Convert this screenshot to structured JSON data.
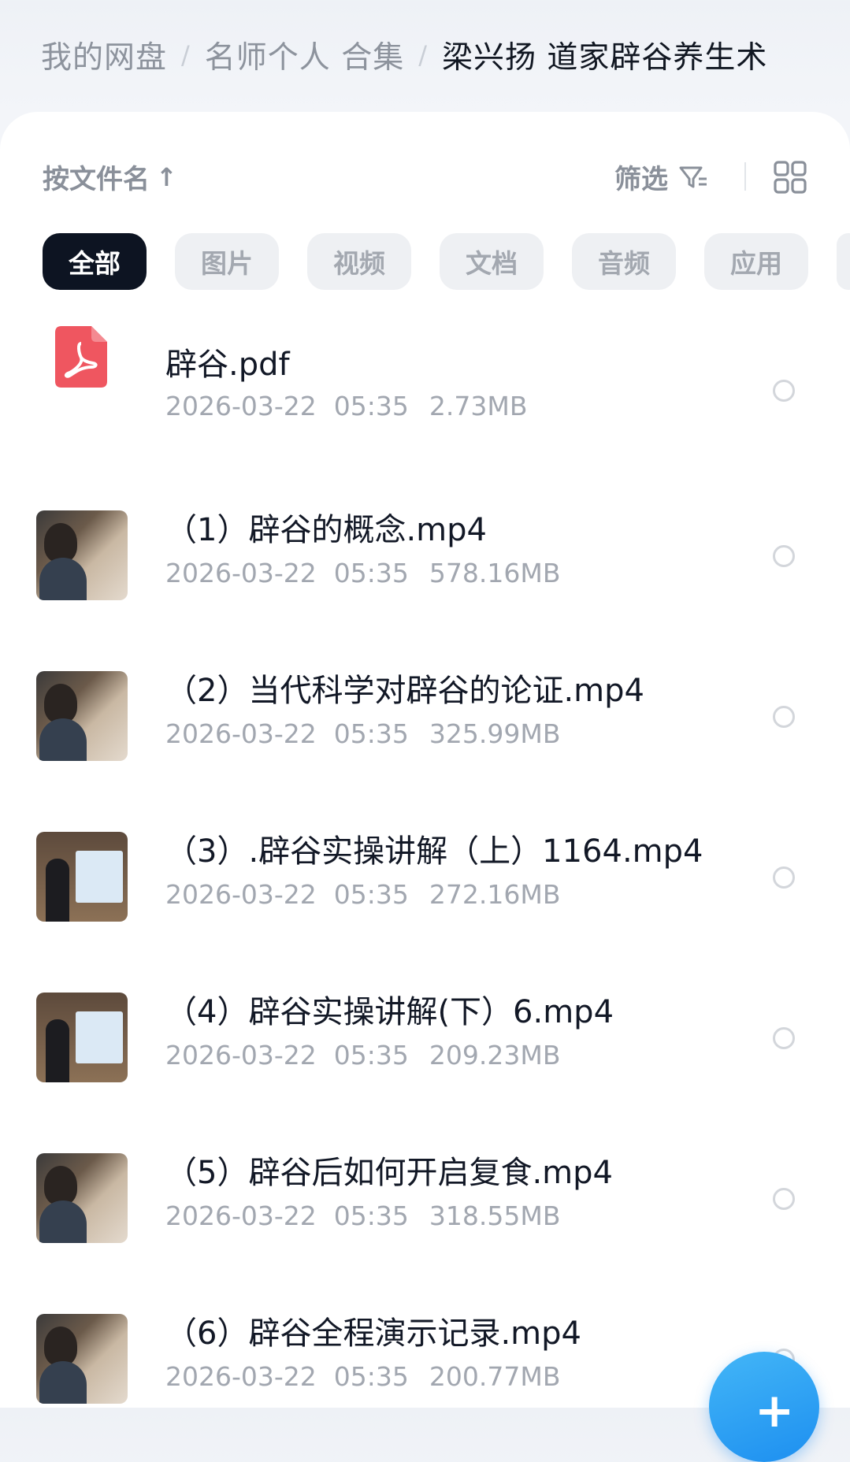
{
  "breadcrumb": {
    "items": [
      "我的网盘",
      "名师个人 合集",
      "梁兴扬 道家辟谷养生术"
    ],
    "separator": "/"
  },
  "toolbar": {
    "sort_label": "按文件名",
    "sort_arrow": "↑",
    "filter_label": "筛选",
    "filter_icon": "filter-icon",
    "view_icon": "grid-view-icon"
  },
  "tabs": [
    {
      "label": "全部",
      "active": true
    },
    {
      "label": "图片",
      "active": false
    },
    {
      "label": "视频",
      "active": false
    },
    {
      "label": "文档",
      "active": false
    },
    {
      "label": "音频",
      "active": false
    },
    {
      "label": "应用",
      "active": false
    }
  ],
  "files": [
    {
      "name": "辟谷.pdf",
      "date": "2026-03-22",
      "time": "05:35",
      "size": "2.73MB",
      "type": "pdf"
    },
    {
      "name": "（1）辟谷的概念.mp4",
      "date": "2026-03-22",
      "time": "05:35",
      "size": "578.16MB",
      "type": "video"
    },
    {
      "name": "（2）当代科学对辟谷的论证.mp4",
      "date": "2026-03-22",
      "time": "05:35",
      "size": "325.99MB",
      "type": "video"
    },
    {
      "name": "（3）.辟谷实操讲解（上）1164.mp4",
      "date": "2026-03-22",
      "time": "05:35",
      "size": "272.16MB",
      "type": "video"
    },
    {
      "name": "（4）辟谷实操讲解(下）6.mp4",
      "date": "2026-03-22",
      "time": "05:35",
      "size": "209.23MB",
      "type": "video"
    },
    {
      "name": "（5）辟谷后如何开启复食.mp4",
      "date": "2026-03-22",
      "time": "05:35",
      "size": "318.55MB",
      "type": "video"
    },
    {
      "name": "（6）辟谷全程演示记录.mp4",
      "date": "2026-03-22",
      "time": "05:35",
      "size": "200.77MB",
      "type": "video"
    }
  ],
  "fab": {
    "label": "+",
    "color": "#2a9cf3"
  },
  "colors": {
    "accent": "#0d1422",
    "pdf": "#ef5660"
  }
}
